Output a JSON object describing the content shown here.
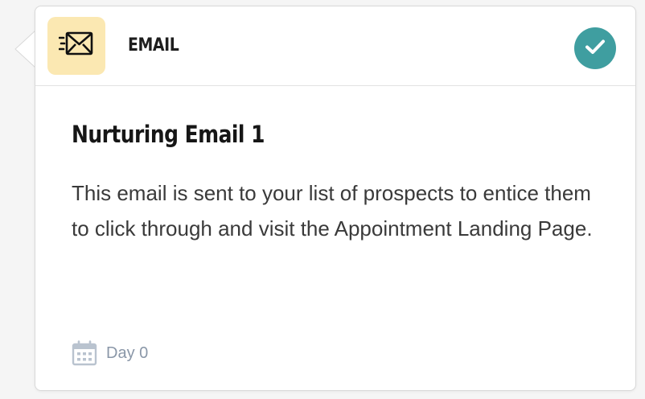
{
  "step": {
    "type_label": "EMAIL",
    "type_icon": "email-fast-icon",
    "status": "completed",
    "status_icon": "check-icon",
    "title": "Nurturing Email 1",
    "description": "This email is sent to your list of prospects to entice them to click through and visit the Appointment Landing Page.",
    "day_label": "Day 0",
    "day_icon": "calendar-icon"
  },
  "colors": {
    "icon_box_bg": "#fbe8b2",
    "status_bg": "#3f9ea0",
    "muted_text": "#8a97a8"
  }
}
